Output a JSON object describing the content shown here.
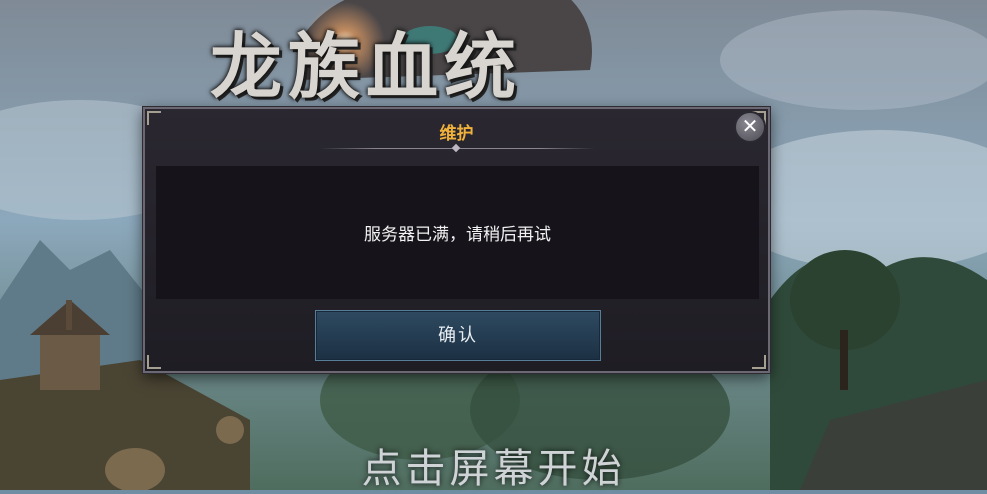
{
  "background": {
    "logo_text": "龙族血统",
    "tap_to_start": "点击屏幕开始"
  },
  "dialog": {
    "title": "维护",
    "message": "服务器已满，请稍后再试",
    "confirm_label": "确认",
    "close_icon": "close-icon"
  },
  "colors": {
    "title_accent": "#f0b23c",
    "button_blue": "#2e4a61"
  }
}
